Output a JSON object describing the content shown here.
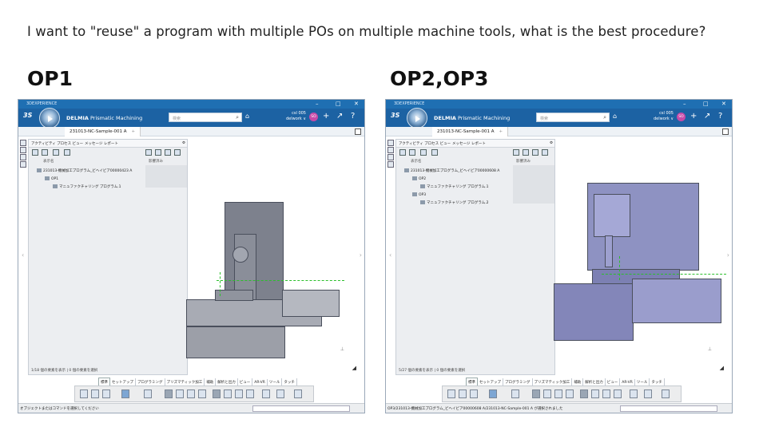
{
  "question": "I want to \"reuse\" a program with multiple POs on multiple machine tools, what is the best procedure?",
  "labels": {
    "left": "OP1",
    "right": "OP2,OP3"
  },
  "left_window": {
    "title": "3DEXPERIENCE",
    "app_brand": "DELMIA",
    "app_name": "Prismatic Machining",
    "search_placeholder": "検索",
    "user_line1": "csl 005",
    "user_line2": "delwork ∨",
    "avatar": "SO",
    "doc_tab": "231013-NC-Sample-001 A",
    "panel_tab1": "アクティビティ プロセス ビュー",
    "panel_tab2": "メッセージ レポート",
    "col_name": "表示名",
    "col_status": "影響済み",
    "tree_root": "231013-機械加工プログラム_ビヘイビア00000423 A",
    "tree_op": "OP1",
    "tree_prog1": "マニュファクチャリング プログラム.1",
    "panel_status": "1/18 個の要素を表示 | 0 個の要素を選択",
    "action_tabs": [
      "標準",
      "セットアップ",
      "プログラミング",
      "プリズマティック加工",
      "補助",
      "解析と出力",
      "ビュー",
      "AR-VR",
      "ツール",
      "タッチ"
    ],
    "status_text": "オブジェクトまたはコマンドを選択してください"
  },
  "right_window": {
    "title": "3DEXPERIENCE",
    "app_brand": "DELMIA",
    "app_name": "Prismatic Machining",
    "search_placeholder": "検索",
    "user_line1": "csl 005",
    "user_line2": "delwork ∨",
    "avatar": "SO",
    "doc_tab": "231013-NC-Sample-001 A",
    "panel_tab1": "アクティビティ プロセス ビュー",
    "panel_tab2": "メッセージ レポート",
    "col_name": "表示名",
    "col_status": "影響済み",
    "tree_root": "231013-機械加工プログラム_ビヘイビア00000608 A",
    "tree_op": "OP2",
    "tree_prog1": "マニュファクチャリング プログラム.1",
    "tree_op2": "OP3",
    "tree_prog2": "マニュファクチャリング プログラム.2",
    "panel_status": "5/27 個の要素を表示 | 0 個の要素を選択",
    "action_tabs": [
      "標準",
      "セットアップ",
      "プログラミング",
      "プリズマティック加工",
      "補助",
      "解析と出力",
      "ビュー",
      "AR-VR",
      "ツール",
      "タッチ"
    ],
    "status_text": "OP3/231013-機械加工プログラム_ビヘイビア00000608 A/231013-NC-Sample-001 A が選択されました"
  }
}
